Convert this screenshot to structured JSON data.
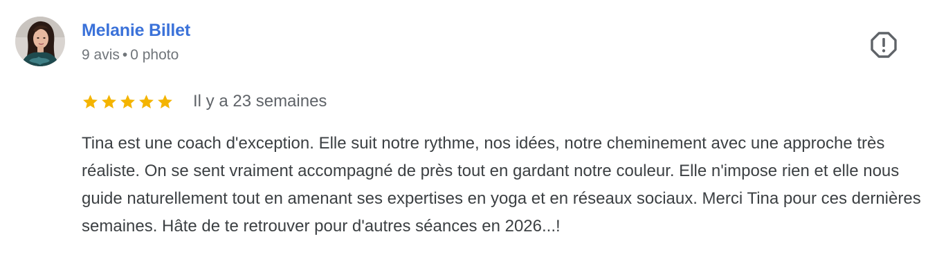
{
  "reviewer": {
    "name": "Melanie Billet",
    "reviews_count": "9 avis",
    "separator": "•",
    "photos_count": "0 photo",
    "avatar_icon": "profile-photo"
  },
  "flag": {
    "icon": "report-flag-icon"
  },
  "rating": {
    "stars": 5,
    "max": 5,
    "star_color": "#f4b400",
    "date": "Il y a 23 semaines"
  },
  "review": {
    "text": "Tina est une coach d'exception. Elle suit notre rythme, nos idées, notre cheminement avec une approche très réaliste. On se sent vraiment accompagné de près tout en gardant notre couleur. Elle n'impose rien et elle nous guide naturellement tout en amenant ses expertises en yoga et en réseaux sociaux. Merci Tina pour ces dernières semaines. Hâte de te retrouver pour d'autres séances en 2026...!"
  },
  "colors": {
    "name_link": "#3b72d9",
    "meta_text": "#70757a",
    "body_text": "#3c4043"
  }
}
